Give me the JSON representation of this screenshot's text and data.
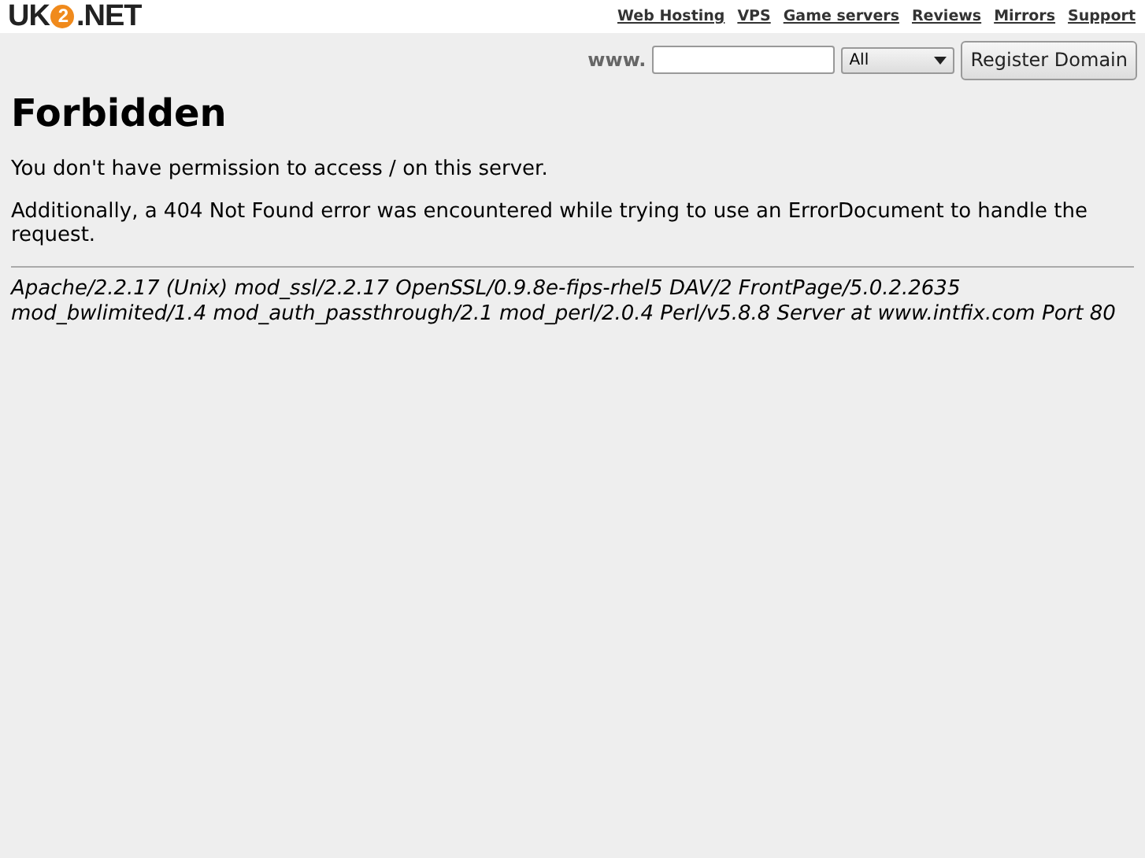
{
  "header": {
    "logo": {
      "before": "UK",
      "badge": "2",
      "after": ".NET"
    },
    "links": [
      "Web Hosting",
      "VPS",
      "Game servers",
      "Reviews",
      "Mirrors",
      "Support"
    ]
  },
  "domain_form": {
    "prefix": "www.",
    "select_value": "All",
    "button": "Register Domain"
  },
  "title": "Forbidden",
  "paragraphs": [
    "You don't have permission to access / on this server.",
    "Additionally, a 404 Not Found error was encountered while trying to use an ErrorDocument to handle the request."
  ],
  "address": "Apache/2.2.17 (Unix) mod_ssl/2.2.17 OpenSSL/0.9.8e-fips-rhel5 DAV/2 FrontPage/5.0.2.2635 mod_bwlimited/1.4 mod_auth_passthrough/2.1 mod_perl/2.0.4 Perl/v5.8.8 Server at www.intfix.com Port 80"
}
